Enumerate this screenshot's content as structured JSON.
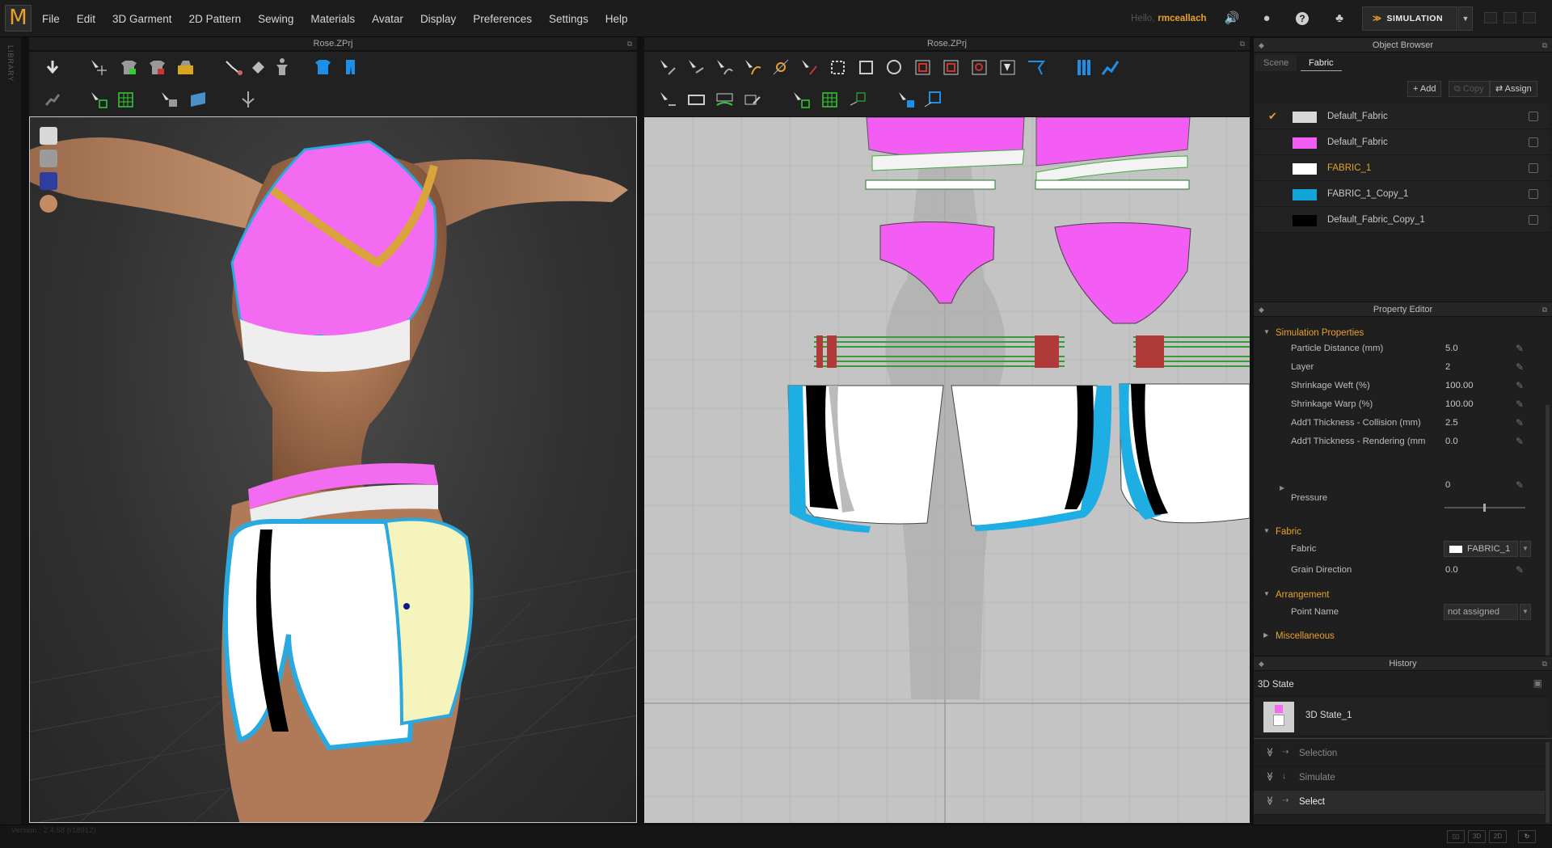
{
  "app": {
    "logo": "M"
  },
  "menu": [
    "File",
    "Edit",
    "3D Garment",
    "2D Pattern",
    "Sewing",
    "Materials",
    "Avatar",
    "Display",
    "Preferences",
    "Settings",
    "Help"
  ],
  "user": {
    "greeting": "Hello,",
    "name": "rmceallach"
  },
  "mode_button": {
    "label": "SIMULATION"
  },
  "library_tab": "LIBRARY",
  "pane3d": {
    "title": "Rose.ZPrj"
  },
  "pane2d": {
    "title": "Rose.ZPrj"
  },
  "object_browser": {
    "title": "Object Browser",
    "tabs": [
      "Scene",
      "Fabric"
    ],
    "active_tab": "Fabric",
    "buttons": {
      "add": "Add",
      "copy": "Copy",
      "assign": "Assign"
    },
    "fabrics": [
      {
        "name": "Default_Fabric",
        "color": "#d8d8d8",
        "checked": true,
        "highlight": false
      },
      {
        "name": "Default_Fabric",
        "color": "#f25ef5",
        "checked": false,
        "highlight": false
      },
      {
        "name": "FABRIC_1",
        "color": "#ffffff",
        "checked": false,
        "highlight": true
      },
      {
        "name": "FABRIC_1_Copy_1",
        "color": "#12a5d9",
        "checked": false,
        "highlight": false
      },
      {
        "name": "Default_Fabric_Copy_1",
        "color": "#000000",
        "checked": false,
        "highlight": false
      }
    ]
  },
  "property_editor": {
    "title": "Property Editor",
    "simulation_group": "Simulation Properties",
    "simulation": [
      {
        "label": "Particle Distance (mm)",
        "value": "5.0"
      },
      {
        "label": "Layer",
        "value": "2"
      },
      {
        "label": "Shrinkage Weft (%)",
        "value": "100.00"
      },
      {
        "label": "Shrinkage Warp (%)",
        "value": "100.00"
      },
      {
        "label": "Add'l Thickness - Collision (mm)",
        "value": "2.5"
      },
      {
        "label": "Add'l Thickness - Rendering (mm",
        "value": "0.0"
      }
    ],
    "pressure": {
      "label": "Pressure",
      "value": "0"
    },
    "fabric_group": "Fabric",
    "fabric": {
      "label": "Fabric",
      "value": "FABRIC_1"
    },
    "grain": {
      "label": "Grain Direction",
      "value": "0.0"
    },
    "arrangement_group": "Arrangement",
    "point_name": {
      "label": "Point Name",
      "value": "not assigned"
    },
    "misc_group": "Miscellaneous"
  },
  "history": {
    "title": "History",
    "state_label": "3D State",
    "state_item": "3D State_1",
    "entries": [
      "Selection",
      "Simulate",
      "Select"
    ]
  },
  "status": {
    "version": "Version : 2.4.58    (r18912)"
  },
  "view_buttons": [
    "3D",
    "2D"
  ]
}
